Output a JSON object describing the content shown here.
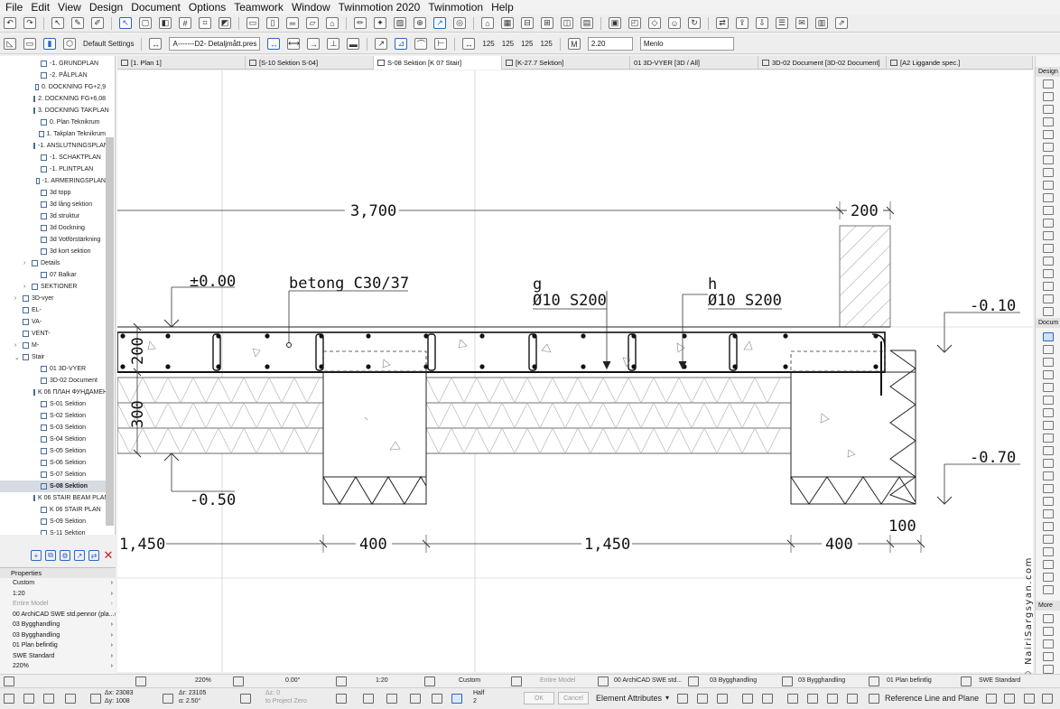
{
  "menu": [
    "File",
    "Edit",
    "View",
    "Design",
    "Document",
    "Options",
    "Teamwork",
    "Window",
    "Twinmotion 2020",
    "Twinmotion",
    "Help"
  ],
  "toolbar2": {
    "settings_label": "Default Settings",
    "layer_value": "A-------D2- Detaljmått.pres",
    "scale_value": "2.20",
    "font_value": "Menlo",
    "dim_a": "125",
    "dim_b": "125",
    "dim_c": "125",
    "dim_d": "125"
  },
  "tabs": [
    "[1. Plan 1]",
    "[S-10 Sektion S-04]",
    "S-08 Sektion  [K 07 Stair]",
    "[K-27.7 Sektion]",
    "01 3D-VYER [3D / All]",
    "3D-02 Document [3D-02 Document]",
    "[A2 Liggande spec.]"
  ],
  "navigator": {
    "items": [
      {
        "label": "-1. GRUNDPLAN",
        "indent": 3,
        "caret": ""
      },
      {
        "label": "-2. PÅLPLAN",
        "indent": 3,
        "caret": ""
      },
      {
        "label": "0. DOCKNING FG+2,9",
        "indent": 3,
        "caret": ""
      },
      {
        "label": "2. DOCKNING FG+6,08",
        "indent": 3,
        "caret": ""
      },
      {
        "label": "3. DOCKNING TAKPLAN",
        "indent": 3,
        "caret": ""
      },
      {
        "label": "0. Plan Teknikrum",
        "indent": 3,
        "caret": ""
      },
      {
        "label": "1. Takplan Teknikrum",
        "indent": 3,
        "caret": ""
      },
      {
        "label": "-1. ANSLUTNINGSPLAN",
        "indent": 3,
        "caret": ""
      },
      {
        "label": "-1. SCHAKTPLAN",
        "indent": 3,
        "caret": ""
      },
      {
        "label": "-1. PLINTPLAN",
        "indent": 3,
        "caret": ""
      },
      {
        "label": "-1. ARMERINGSPLAN",
        "indent": 3,
        "caret": ""
      },
      {
        "label": "3d topp",
        "indent": 3,
        "caret": ""
      },
      {
        "label": "3d lång sektion",
        "indent": 3,
        "caret": ""
      },
      {
        "label": "3d struktur",
        "indent": 3,
        "caret": ""
      },
      {
        "label": "3d Dockning",
        "indent": 3,
        "caret": ""
      },
      {
        "label": "3d Votförstärkning",
        "indent": 3,
        "caret": ""
      },
      {
        "label": "3d kort sektion",
        "indent": 3,
        "caret": ""
      },
      {
        "label": "Details",
        "indent": 2,
        "caret": "›"
      },
      {
        "label": "07 Balkar",
        "indent": 3,
        "caret": ""
      },
      {
        "label": "SEKTIONER",
        "indent": 2,
        "caret": "›"
      },
      {
        "label": "3D-vyer",
        "indent": 1,
        "caret": "›"
      },
      {
        "label": "EL-",
        "indent": 1,
        "caret": ""
      },
      {
        "label": "VA-",
        "indent": 1,
        "caret": ""
      },
      {
        "label": "VENT-",
        "indent": 1,
        "caret": ""
      },
      {
        "label": "M-",
        "indent": 1,
        "caret": "›"
      },
      {
        "label": "Stair",
        "indent": 1,
        "caret": "⌄"
      },
      {
        "label": "01 3D-VYER",
        "indent": 3,
        "caret": ""
      },
      {
        "label": "3D-02 Document",
        "indent": 3,
        "caret": ""
      },
      {
        "label": "K 06 ПЛАН ФУНДАМЕНТ",
        "indent": 3,
        "caret": ""
      },
      {
        "label": "S-01 Sektion",
        "indent": 3,
        "caret": ""
      },
      {
        "label": "S-02 Sektion",
        "indent": 3,
        "caret": ""
      },
      {
        "label": "S-03 Sektion",
        "indent": 3,
        "caret": ""
      },
      {
        "label": "S-04 Sektion",
        "indent": 3,
        "caret": ""
      },
      {
        "label": "S-05 Sektion",
        "indent": 3,
        "caret": ""
      },
      {
        "label": "S-06 Sektion",
        "indent": 3,
        "caret": ""
      },
      {
        "label": "S-07 Sektion",
        "indent": 3,
        "caret": ""
      },
      {
        "label": "S-08 Sektion",
        "indent": 3,
        "caret": "",
        "selected": true
      },
      {
        "label": "K 06 STAIR BEAM PLAN",
        "indent": 3,
        "caret": ""
      },
      {
        "label": "K 06 STAIR PLAN",
        "indent": 3,
        "caret": ""
      },
      {
        "label": "S-09 Sektion",
        "indent": 3,
        "caret": ""
      },
      {
        "label": "S-11 Sektion",
        "indent": 3,
        "caret": ""
      }
    ]
  },
  "properties": {
    "title": "Properties",
    "rows": [
      {
        "label": "Custom",
        "dim": false
      },
      {
        "label": "1:20",
        "dim": false
      },
      {
        "label": "Entire Model",
        "dim": true
      },
      {
        "label": "00 ArchiCAD SWE std.pennor (pla...",
        "dim": false
      },
      {
        "label": "03 Bygghandling",
        "dim": false
      },
      {
        "label": "03 Bygghandling",
        "dim": false
      },
      {
        "label": "01 Plan befintlig",
        "dim": false
      },
      {
        "label": "SWE Standard",
        "dim": false
      },
      {
        "label": "220%",
        "dim": false
      },
      {
        "label": "0.00°",
        "dim": false
      }
    ]
  },
  "drawing": {
    "dims_top": {
      "main": "3,700",
      "right": "200"
    },
    "levels": {
      "top": "±0.00",
      "bottom": "-0.50",
      "right_top": "-0.10",
      "right_bottom": "-0.70"
    },
    "labels": {
      "concrete": "betong C30/37",
      "g": "g",
      "g_rebar": "Ø10 S200",
      "h": "h",
      "h_rebar": "Ø10 S200"
    },
    "vertical_dims": {
      "slab": "200",
      "fill": "300"
    },
    "dims_bottom": {
      "d1": "1,450",
      "d2": "400",
      "d3": "1,450",
      "d4": "400",
      "d5": "100"
    }
  },
  "toolbox": {
    "design_label": "Design",
    "docum_label": "Docum",
    "more_label": "More"
  },
  "watermark": "© NairiSargsyan.com",
  "status1": {
    "zoom": "220%",
    "angle": "0.00°",
    "scale": "1:20",
    "structure": "Custom",
    "model": "Entire Model",
    "pens": "00 ArchiCAD SWE std...",
    "layer1": "03 Bygghandling",
    "layer2": "03 Bygghandling",
    "renovation": "01 Plan befintlig",
    "dim_std": "SWE Standard"
  },
  "status2": {
    "dx": "Δx: 23083",
    "dy": "Δy: 1008",
    "dr": "Δr: 23105",
    "da": "α: 2.50°",
    "dz_label": "Δz: 0",
    "dz_ref": "to Project Zero",
    "half_label": "Half",
    "half_value": "2",
    "ok": "OK",
    "cancel": "Cancel",
    "element_attributes": "Element Attributes",
    "reference": "Reference Line and Plane"
  }
}
